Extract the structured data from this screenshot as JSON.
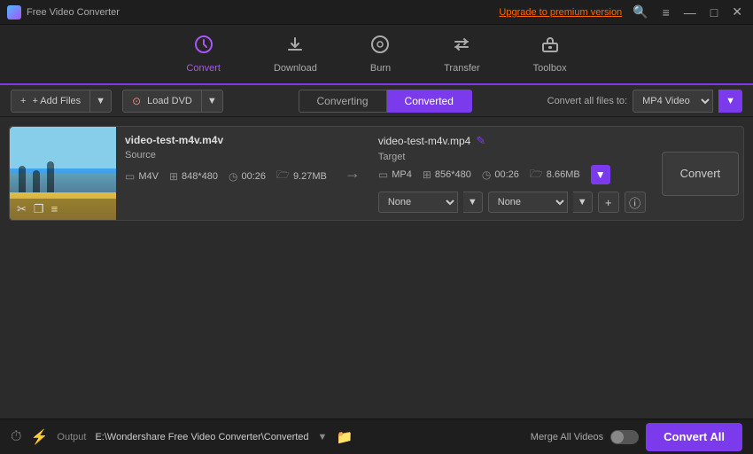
{
  "titleBar": {
    "appName": "Free Video Converter",
    "upgradeText": "Upgrade to premium version",
    "windowControls": [
      "🔍",
      "≡",
      "—",
      "□",
      "✕"
    ]
  },
  "nav": {
    "items": [
      {
        "id": "convert",
        "label": "Convert",
        "icon": "↻",
        "active": true
      },
      {
        "id": "download",
        "label": "Download",
        "icon": "⬇",
        "active": false
      },
      {
        "id": "burn",
        "label": "Burn",
        "icon": "⊙",
        "active": false
      },
      {
        "id": "transfer",
        "label": "Transfer",
        "icon": "⇄",
        "active": false
      },
      {
        "id": "toolbox",
        "label": "Toolbox",
        "icon": "⊞",
        "active": false
      }
    ]
  },
  "toolbar": {
    "addFilesLabel": "+ Add Files",
    "loadDvdLabel": "⊙ Load DVD",
    "tabs": [
      {
        "id": "converting",
        "label": "Converting",
        "active": false
      },
      {
        "id": "converted",
        "label": "Converted",
        "active": true
      }
    ],
    "convertAllLabel": "Convert all files to:",
    "formatValue": "MP4 Video"
  },
  "fileItem": {
    "sourceName": "video-test-m4v.m4v",
    "targetName": "video-test-m4v.mp4",
    "source": {
      "label": "Source",
      "format": "M4V",
      "resolution": "848*480",
      "duration": "00:26",
      "size": "9.27MB"
    },
    "target": {
      "label": "Target",
      "format": "MP4",
      "resolution": "856*480",
      "duration": "00:26",
      "size": "8.66MB"
    },
    "effectNone1": "None",
    "effectNone2": "None",
    "convertBtnLabel": "Convert"
  },
  "statusBar": {
    "outputLabel": "Output",
    "outputPath": "E:\\Wondershare Free Video Converter\\Converted",
    "mergeLabel": "Merge All Videos",
    "convertAllLabel": "Convert All"
  },
  "icons": {
    "scissors": "✂",
    "copy": "❐",
    "menu": "≡",
    "edit": "✎",
    "arrow": "→",
    "plusMinus": "±",
    "info": "ⓘ",
    "clock": "⏱",
    "lightning": "⚡",
    "folder": "📁",
    "dropdown": "▼"
  }
}
